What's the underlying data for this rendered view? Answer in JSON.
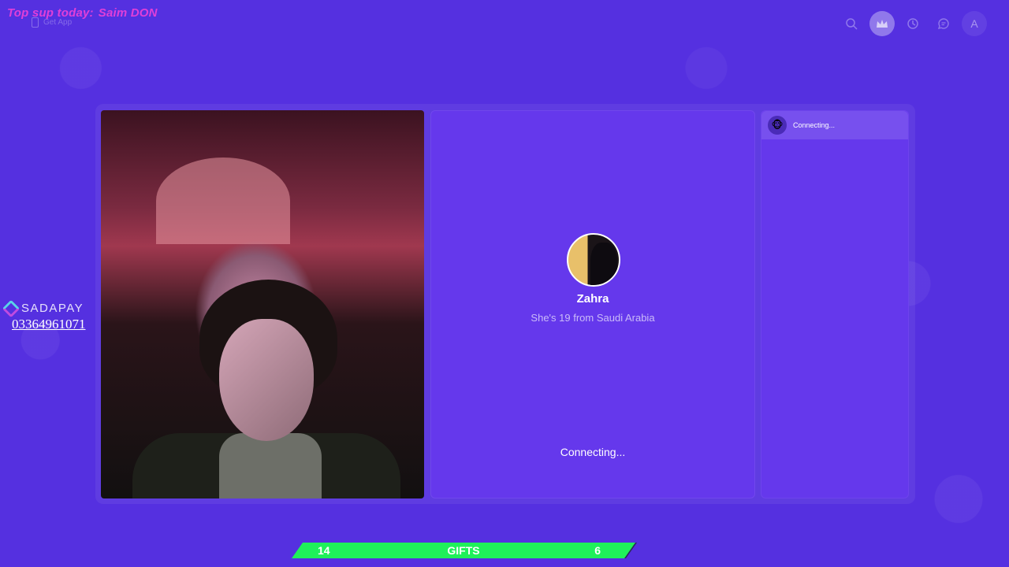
{
  "overlay": {
    "top_sup_label": "Top sup today:",
    "top_sup_name": "Saim DON",
    "get_app": "Get App"
  },
  "header": {
    "icons": [
      "search-icon",
      "crown-icon",
      "history-icon",
      "chat-icon"
    ],
    "avatar_letter": "A"
  },
  "partner": {
    "name": "Zahra",
    "subtitle": "She's 19 from Saudi Arabia",
    "status": "Connecting..."
  },
  "chat": {
    "row_text": "Connecting...",
    "row_emoji": "🐵"
  },
  "sadapay": {
    "brand": "SADAPAY",
    "number": "03364961071"
  },
  "gifts": {
    "left_count": "14",
    "label": "GIFTS",
    "right_count": "6"
  },
  "colors": {
    "background": "#5530e0",
    "panel": "#6538ec",
    "gifts_bar": "#1ff05a",
    "top_sup": "#e03fd8"
  }
}
